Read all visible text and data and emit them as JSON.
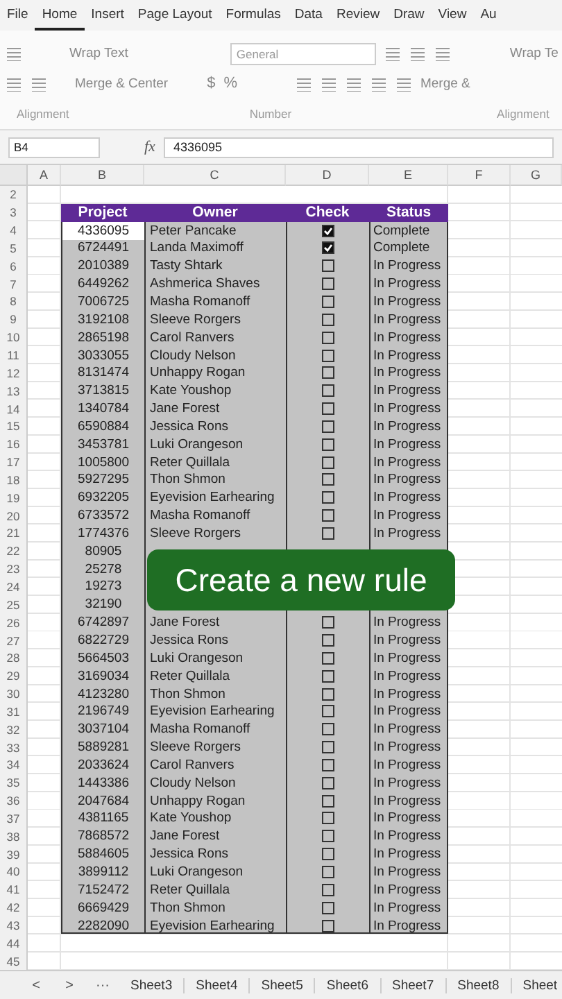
{
  "menu_tabs": [
    {
      "label": "File",
      "selected": false
    },
    {
      "label": "Home",
      "selected": true
    },
    {
      "label": "Insert",
      "selected": false
    },
    {
      "label": "Page Layout",
      "selected": false
    },
    {
      "label": "Formulas",
      "selected": false
    },
    {
      "label": "Data",
      "selected": false
    },
    {
      "label": "Review",
      "selected": false
    },
    {
      "label": "Draw",
      "selected": false
    },
    {
      "label": "View",
      "selected": false
    },
    {
      "label": "Au",
      "selected": false
    }
  ],
  "ribbon": {
    "wrap_text": "Wrap Text",
    "merge_center": "Merge & Center",
    "number_format": "General",
    "currency": "$",
    "percent": "%",
    "wrap_text_cut": "Wrap Te",
    "merge_cut": "Merge &",
    "groups": [
      "Alignment",
      "Number",
      "Alignment"
    ]
  },
  "formula_bar": {
    "name_box": "B4",
    "fx": "fx",
    "value": "4336095"
  },
  "columns": [
    "A",
    "B",
    "C",
    "D",
    "E",
    "F",
    "G"
  ],
  "row_numbers": [
    "2",
    "3",
    "4",
    "5",
    "6",
    "7",
    "8",
    "9",
    "10",
    "11",
    "12",
    "13",
    "14",
    "15",
    "16",
    "17",
    "18",
    "19",
    "20",
    "21",
    "22",
    "23",
    "24",
    "25",
    "26",
    "27",
    "28",
    "29",
    "30",
    "31",
    "32",
    "33",
    "34",
    "35",
    "36",
    "37",
    "38",
    "39",
    "40",
    "41",
    "42",
    "43",
    "44",
    "45"
  ],
  "table": {
    "headers": [
      "Project",
      "Owner",
      "Check",
      "Status"
    ],
    "rows": [
      {
        "project": "4336095",
        "owner": "Peter Pancake",
        "checked": true,
        "status": "Complete",
        "active": true
      },
      {
        "project": "6724491",
        "owner": "Landa Maximoff",
        "checked": true,
        "status": "Complete",
        "active": false
      },
      {
        "project": "2010389",
        "owner": "Tasty Shtark",
        "checked": false,
        "status": "In Progress",
        "active": false
      },
      {
        "project": "6449262",
        "owner": "Ashmerica Shaves",
        "checked": false,
        "status": "In Progress",
        "active": false
      },
      {
        "project": "7006725",
        "owner": "Masha Romanoff",
        "checked": false,
        "status": "In Progress",
        "active": false
      },
      {
        "project": "3192108",
        "owner": "Sleeve Rorgers",
        "checked": false,
        "status": "In Progress",
        "active": false
      },
      {
        "project": "2865198",
        "owner": "Carol Ranvers",
        "checked": false,
        "status": "In Progress",
        "active": false
      },
      {
        "project": "3033055",
        "owner": "Cloudy Nelson",
        "checked": false,
        "status": "In Progress",
        "active": false
      },
      {
        "project": "8131474",
        "owner": "Unhappy Rogan",
        "checked": false,
        "status": "In Progress",
        "active": false
      },
      {
        "project": "3713815",
        "owner": "Kate Youshop",
        "checked": false,
        "status": "In Progress",
        "active": false
      },
      {
        "project": "1340784",
        "owner": "Jane Forest",
        "checked": false,
        "status": "In Progress",
        "active": false
      },
      {
        "project": "6590884",
        "owner": "Jessica Rons",
        "checked": false,
        "status": "In Progress",
        "active": false
      },
      {
        "project": "3453781",
        "owner": "Luki Orangeson",
        "checked": false,
        "status": "In Progress",
        "active": false
      },
      {
        "project": "1005800",
        "owner": "Reter Quillala",
        "checked": false,
        "status": "In Progress",
        "active": false
      },
      {
        "project": "5927295",
        "owner": "Thon Shmon",
        "checked": false,
        "status": "In Progress",
        "active": false
      },
      {
        "project": "6932205",
        "owner": "Eyevision Earhearing",
        "checked": false,
        "status": "In Progress",
        "active": false
      },
      {
        "project": "6733572",
        "owner": "Masha Romanoff",
        "checked": false,
        "status": "In Progress",
        "active": false
      },
      {
        "project": "1774376",
        "owner": "Sleeve Rorgers",
        "checked": false,
        "status": "In Progress",
        "active": false
      },
      {
        "project": "80905",
        "active": false
      },
      {
        "project": "25278",
        "active": false
      },
      {
        "project": "19273",
        "active": false
      },
      {
        "project": "32190",
        "active": false
      },
      {
        "project": "6742897",
        "owner": "Jane Forest",
        "checked": false,
        "status": "In Progress",
        "active": false
      },
      {
        "project": "6822729",
        "owner": "Jessica Rons",
        "checked": false,
        "status": "In Progress",
        "active": false
      },
      {
        "project": "5664503",
        "owner": "Luki Orangeson",
        "checked": false,
        "status": "In Progress",
        "active": false
      },
      {
        "project": "3169034",
        "owner": "Reter Quillala",
        "checked": false,
        "status": "In Progress",
        "active": false
      },
      {
        "project": "4123280",
        "owner": "Thon Shmon",
        "checked": false,
        "status": "In Progress",
        "active": false
      },
      {
        "project": "2196749",
        "owner": "Eyevision Earhearing",
        "checked": false,
        "status": "In Progress",
        "active": false
      },
      {
        "project": "3037104",
        "owner": "Masha Romanoff",
        "checked": false,
        "status": "In Progress",
        "active": false
      },
      {
        "project": "5889281",
        "owner": "Sleeve Rorgers",
        "checked": false,
        "status": "In Progress",
        "active": false
      },
      {
        "project": "2033624",
        "owner": "Carol Ranvers",
        "checked": false,
        "status": "In Progress",
        "active": false
      },
      {
        "project": "1443386",
        "owner": "Cloudy Nelson",
        "checked": false,
        "status": "In Progress",
        "active": false
      },
      {
        "project": "2047684",
        "owner": "Unhappy Rogan",
        "checked": false,
        "status": "In Progress",
        "active": false
      },
      {
        "project": "4381165",
        "owner": "Kate Youshop",
        "checked": false,
        "status": "In Progress",
        "active": false
      },
      {
        "project": "7868572",
        "owner": "Jane Forest",
        "checked": false,
        "status": "In Progress",
        "active": false
      },
      {
        "project": "5884605",
        "owner": "Jessica Rons",
        "checked": false,
        "status": "In Progress",
        "active": false
      },
      {
        "project": "3899112",
        "owner": "Luki Orangeson",
        "checked": false,
        "status": "In Progress",
        "active": false
      },
      {
        "project": "7152472",
        "owner": "Reter Quillala",
        "checked": false,
        "status": "In Progress",
        "active": false
      },
      {
        "project": "6669429",
        "owner": "Thon Shmon",
        "checked": false,
        "status": "In Progress",
        "active": false
      },
      {
        "project": "2282090",
        "owner": "Eyevision Earhearing",
        "checked": false,
        "status": "In Progress",
        "active": false
      }
    ]
  },
  "caption": "Create a new rule",
  "sheet_nav": [
    "<",
    ">",
    "···"
  ],
  "sheet_tabs": [
    "Sheet3",
    "Sheet4",
    "Sheet5",
    "Sheet6",
    "Sheet7",
    "Sheet8",
    "Sheet"
  ]
}
